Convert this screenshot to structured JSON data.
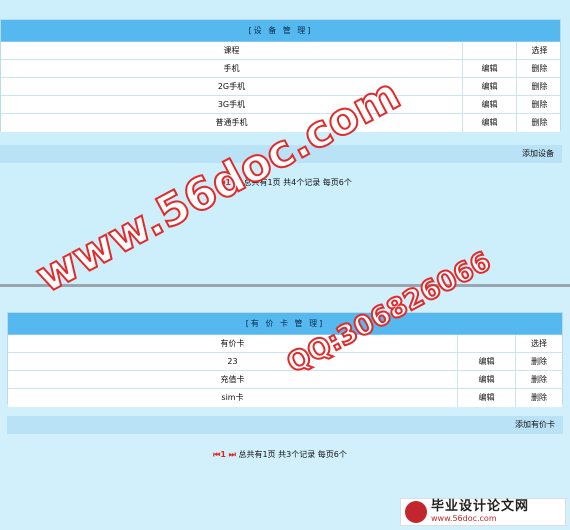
{
  "device_section": {
    "title": "[设 备 管 理]",
    "columns": [
      "课程",
      "",
      "选择"
    ],
    "rows": [
      {
        "name": "手机",
        "edit": "编辑",
        "delete": "删除"
      },
      {
        "name": "2G手机",
        "edit": "编辑",
        "delete": "删除"
      },
      {
        "name": "3G手机",
        "edit": "编辑",
        "delete": "删除"
      },
      {
        "name": "普通手机",
        "edit": "编辑",
        "delete": "删除"
      }
    ],
    "add_label": "添加设备",
    "pager": {
      "nav": "⏮1 ⏭",
      "text": "总共有1页 共4个记录 每页6个"
    }
  },
  "card_section": {
    "title": "[有 价 卡 管 理]",
    "columns": [
      "有价卡",
      "",
      "选择"
    ],
    "rows": [
      {
        "name": "23",
        "edit": "编辑",
        "delete": "删除"
      },
      {
        "name": "充值卡",
        "edit": "编辑",
        "delete": "删除"
      },
      {
        "name": "sim卡",
        "edit": "编辑",
        "delete": "删除"
      }
    ],
    "add_label": "添加有价卡",
    "pager": {
      "nav": "⏮1 ⏭",
      "text": "总共有1页 共3个记录 每页6个"
    }
  },
  "watermark": {
    "site": "www.56doc.com",
    "qq": "QQ:306826066",
    "brand": "毕业设计论文网",
    "brand_url": "www.56doc.com"
  },
  "colors": {
    "header": "#55b8ee",
    "background": "#cdeefb",
    "pager_nav": "#e0261b",
    "watermark": "#e32a2a"
  }
}
